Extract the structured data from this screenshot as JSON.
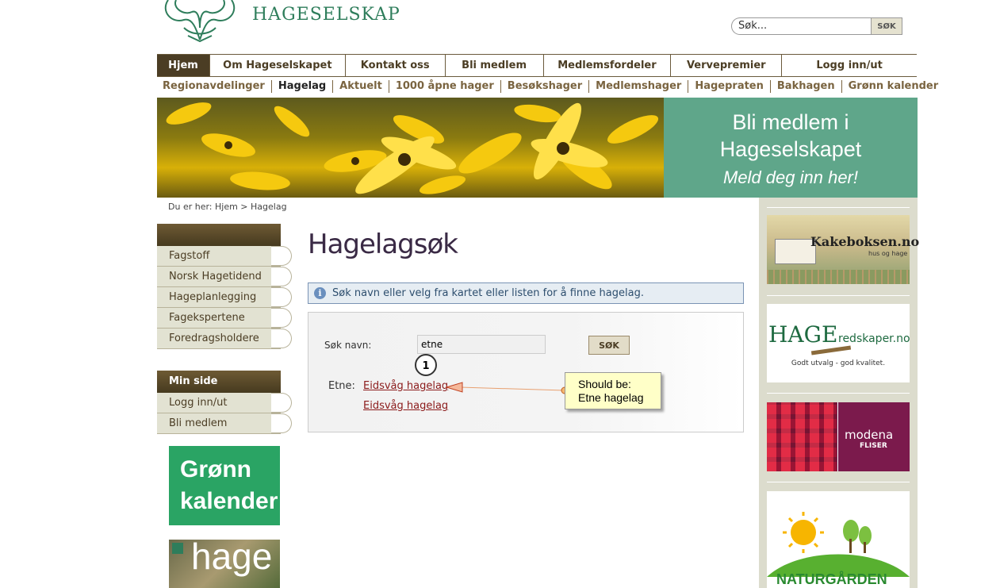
{
  "header": {
    "site_name": "HAGESELSKAP",
    "search_placeholder": "Søk...",
    "search_button": "SØK"
  },
  "main_nav": [
    {
      "label": "Hjem",
      "active": true
    },
    {
      "label": "Om Hageselskapet"
    },
    {
      "label": "Kontakt oss"
    },
    {
      "label": "Bli medlem"
    },
    {
      "label": "Medlemsfordeler"
    },
    {
      "label": "Vervepremier"
    },
    {
      "label": "Logg inn/ut"
    }
  ],
  "sub_nav": [
    {
      "label": "Regionavdelinger"
    },
    {
      "label": "Hagelag",
      "current": true
    },
    {
      "label": "Aktuelt"
    },
    {
      "label": "1000 åpne hager"
    },
    {
      "label": "Besøkshager"
    },
    {
      "label": "Medlemshager"
    },
    {
      "label": "Hagepraten"
    },
    {
      "label": "Bakhagen"
    },
    {
      "label": "Grønn kalender"
    }
  ],
  "banner": {
    "cta_line1": "Bli medlem i",
    "cta_line2": "Hageselskapet",
    "cta_line3": "Meld deg inn her!"
  },
  "breadcrumb": "Du er her: Hjem > Hagelag",
  "left_nav": {
    "section1_items": [
      "Fagstoff",
      "Norsk Hagetidend",
      "Hageplanlegging",
      "Fagekspertene",
      "Foredragsholdere"
    ],
    "section2_title": "Min side",
    "section2_items": [
      "Logg inn/ut",
      "Bli medlem"
    ],
    "promo_line1": "Grønn",
    "promo_line2": "kalender",
    "magazine_title": "hage"
  },
  "main": {
    "title": "Hagelagsøk",
    "info_text": "Søk navn eller velg fra kartet eller listen for å finne hagelag.",
    "search_label": "Søk navn:",
    "search_value": "etne",
    "search_button": "SØK",
    "result_label": "Etne:",
    "results": [
      "Eidsvåg hagelag",
      "Eidsvåg hagelag"
    ]
  },
  "annotation": {
    "marker": "1",
    "note_line1": "Should be:",
    "note_line2": "Etne hagelag"
  },
  "right_ads": {
    "ad1_text": "Kakeboksen.no",
    "ad1_sub": "hus og hage",
    "ad2_text_big": "HAGE",
    "ad2_text_small": "redskaper.no",
    "ad2_tagline": "Godt utvalg - god kvalitet.",
    "ad3_brand": "modena",
    "ad3_sub": "FLISER",
    "ad4_text": "NATURGÅRDEN"
  },
  "colors": {
    "brand_green": "#2e7d5b",
    "nav_brown": "#4b3d24",
    "cta_green": "#5fa68a",
    "link_red": "#8b1a1a"
  }
}
